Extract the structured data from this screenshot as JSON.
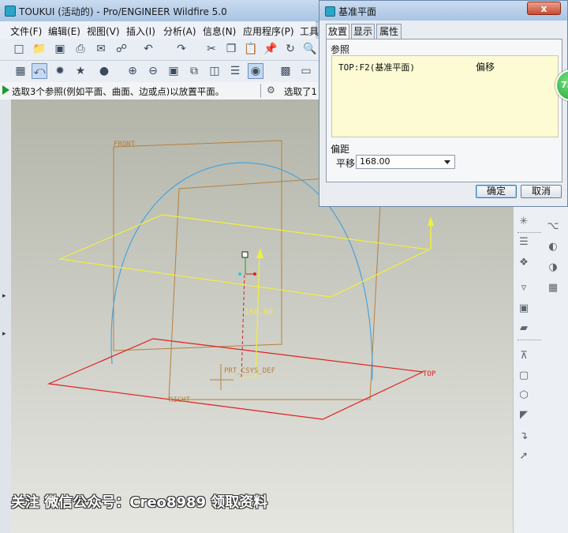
{
  "app": {
    "title": "TOUKUI (活动的) - Pro/ENGINEER Wildfire 5.0"
  },
  "menu": [
    "文件(F)",
    "编辑(E)",
    "视图(V)",
    "插入(I)",
    "分析(A)",
    "信息(N)",
    "应用程序(P)",
    "工具"
  ],
  "status": {
    "message": "选取3个参照(例如平面、曲面、边或点)以放置平面。",
    "selection": "选取了1"
  },
  "dialog": {
    "title": "基准平面",
    "close_label": "x",
    "tabs": [
      "放置",
      "显示",
      "属性"
    ],
    "references_label": "参照",
    "reference": {
      "name": "TOP:F2(基准平面)",
      "constraint": "偏移"
    },
    "offset_label": "偏距",
    "translate_label": "平移",
    "offset_value": "168.00",
    "ok_label": "确定",
    "cancel_label": "取消"
  },
  "badge": "73",
  "model": {
    "front_label": "FRONT",
    "right_label": "RIGHT",
    "top_label": "TOP",
    "csys_label": "PRT_CSYS_DEF",
    "offset_dim": "168.00"
  },
  "watermark": "关注 微信公众号：Creo8989 领取资料",
  "colors": {
    "datum_plane": "#b5803e",
    "selected_plane": "#e02020",
    "preview_plane": "#f0f03c",
    "sketch_arc": "#4aa4dd",
    "dialog_title_bg": "#b8cfea"
  }
}
